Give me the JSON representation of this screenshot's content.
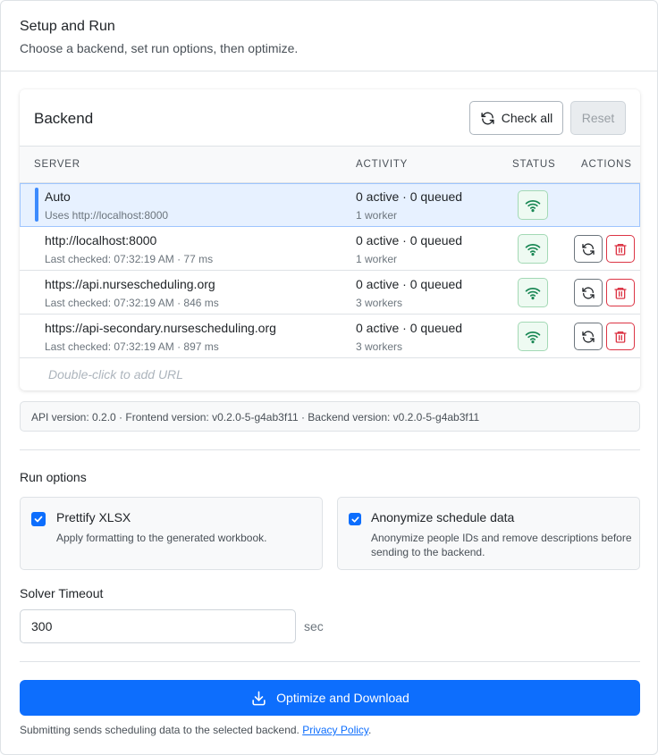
{
  "header": {
    "title": "Setup and Run",
    "subtitle": "Choose a backend, set run options, then optimize."
  },
  "backend": {
    "title": "Backend",
    "check_all_label": "Check all",
    "reset_label": "Reset",
    "columns": {
      "server": "SERVER",
      "activity": "ACTIVITY",
      "status": "STATUS",
      "actions": "ACTIONS"
    },
    "rows": [
      {
        "name": "Auto",
        "sub": "Uses http://localhost:8000",
        "activity": "0 active · 0 queued",
        "workers": "1 worker",
        "selected": true
      },
      {
        "name": "http://localhost:8000",
        "sub": "Last checked: 07:32:19 AM · 77 ms",
        "activity": "0 active · 0 queued",
        "workers": "1 worker"
      },
      {
        "name": "https://api.nursescheduling.org",
        "sub": "Last checked: 07:32:19 AM · 846 ms",
        "activity": "0 active · 0 queued",
        "workers": "3 workers"
      },
      {
        "name": "https://api-secondary.nursescheduling.org",
        "sub": "Last checked: 07:32:19 AM · 897 ms",
        "activity": "0 active · 0 queued",
        "workers": "3 workers"
      }
    ],
    "add_url_placeholder": "Double-click to add URL",
    "status_icon": "wifi-icon",
    "status_color": "#198754"
  },
  "version_info": "API version: 0.2.0 · Frontend version: v0.2.0-5-g4ab3f11 · Backend version: v0.2.0-5-g4ab3f11",
  "run_options": {
    "title": "Run options",
    "prettify": {
      "label": "Prettify XLSX",
      "desc": "Apply formatting to the generated workbook.",
      "checked": true
    },
    "anonymize": {
      "label": "Anonymize schedule data",
      "desc_line1": "Anonymize people IDs and remove descriptions before",
      "desc_line2": "sending to the backend.",
      "checked": true
    }
  },
  "solver": {
    "label": "Solver Timeout",
    "value": "300",
    "unit": "sec"
  },
  "submit": {
    "label": "Optimize and Download",
    "footnote_text": "Submitting sends scheduling data to the selected backend. ",
    "privacy_link": "Privacy Policy",
    "footnote_end": "."
  },
  "colors": {
    "primary": "#0d6efd",
    "danger": "#dc3545",
    "success": "#198754"
  }
}
